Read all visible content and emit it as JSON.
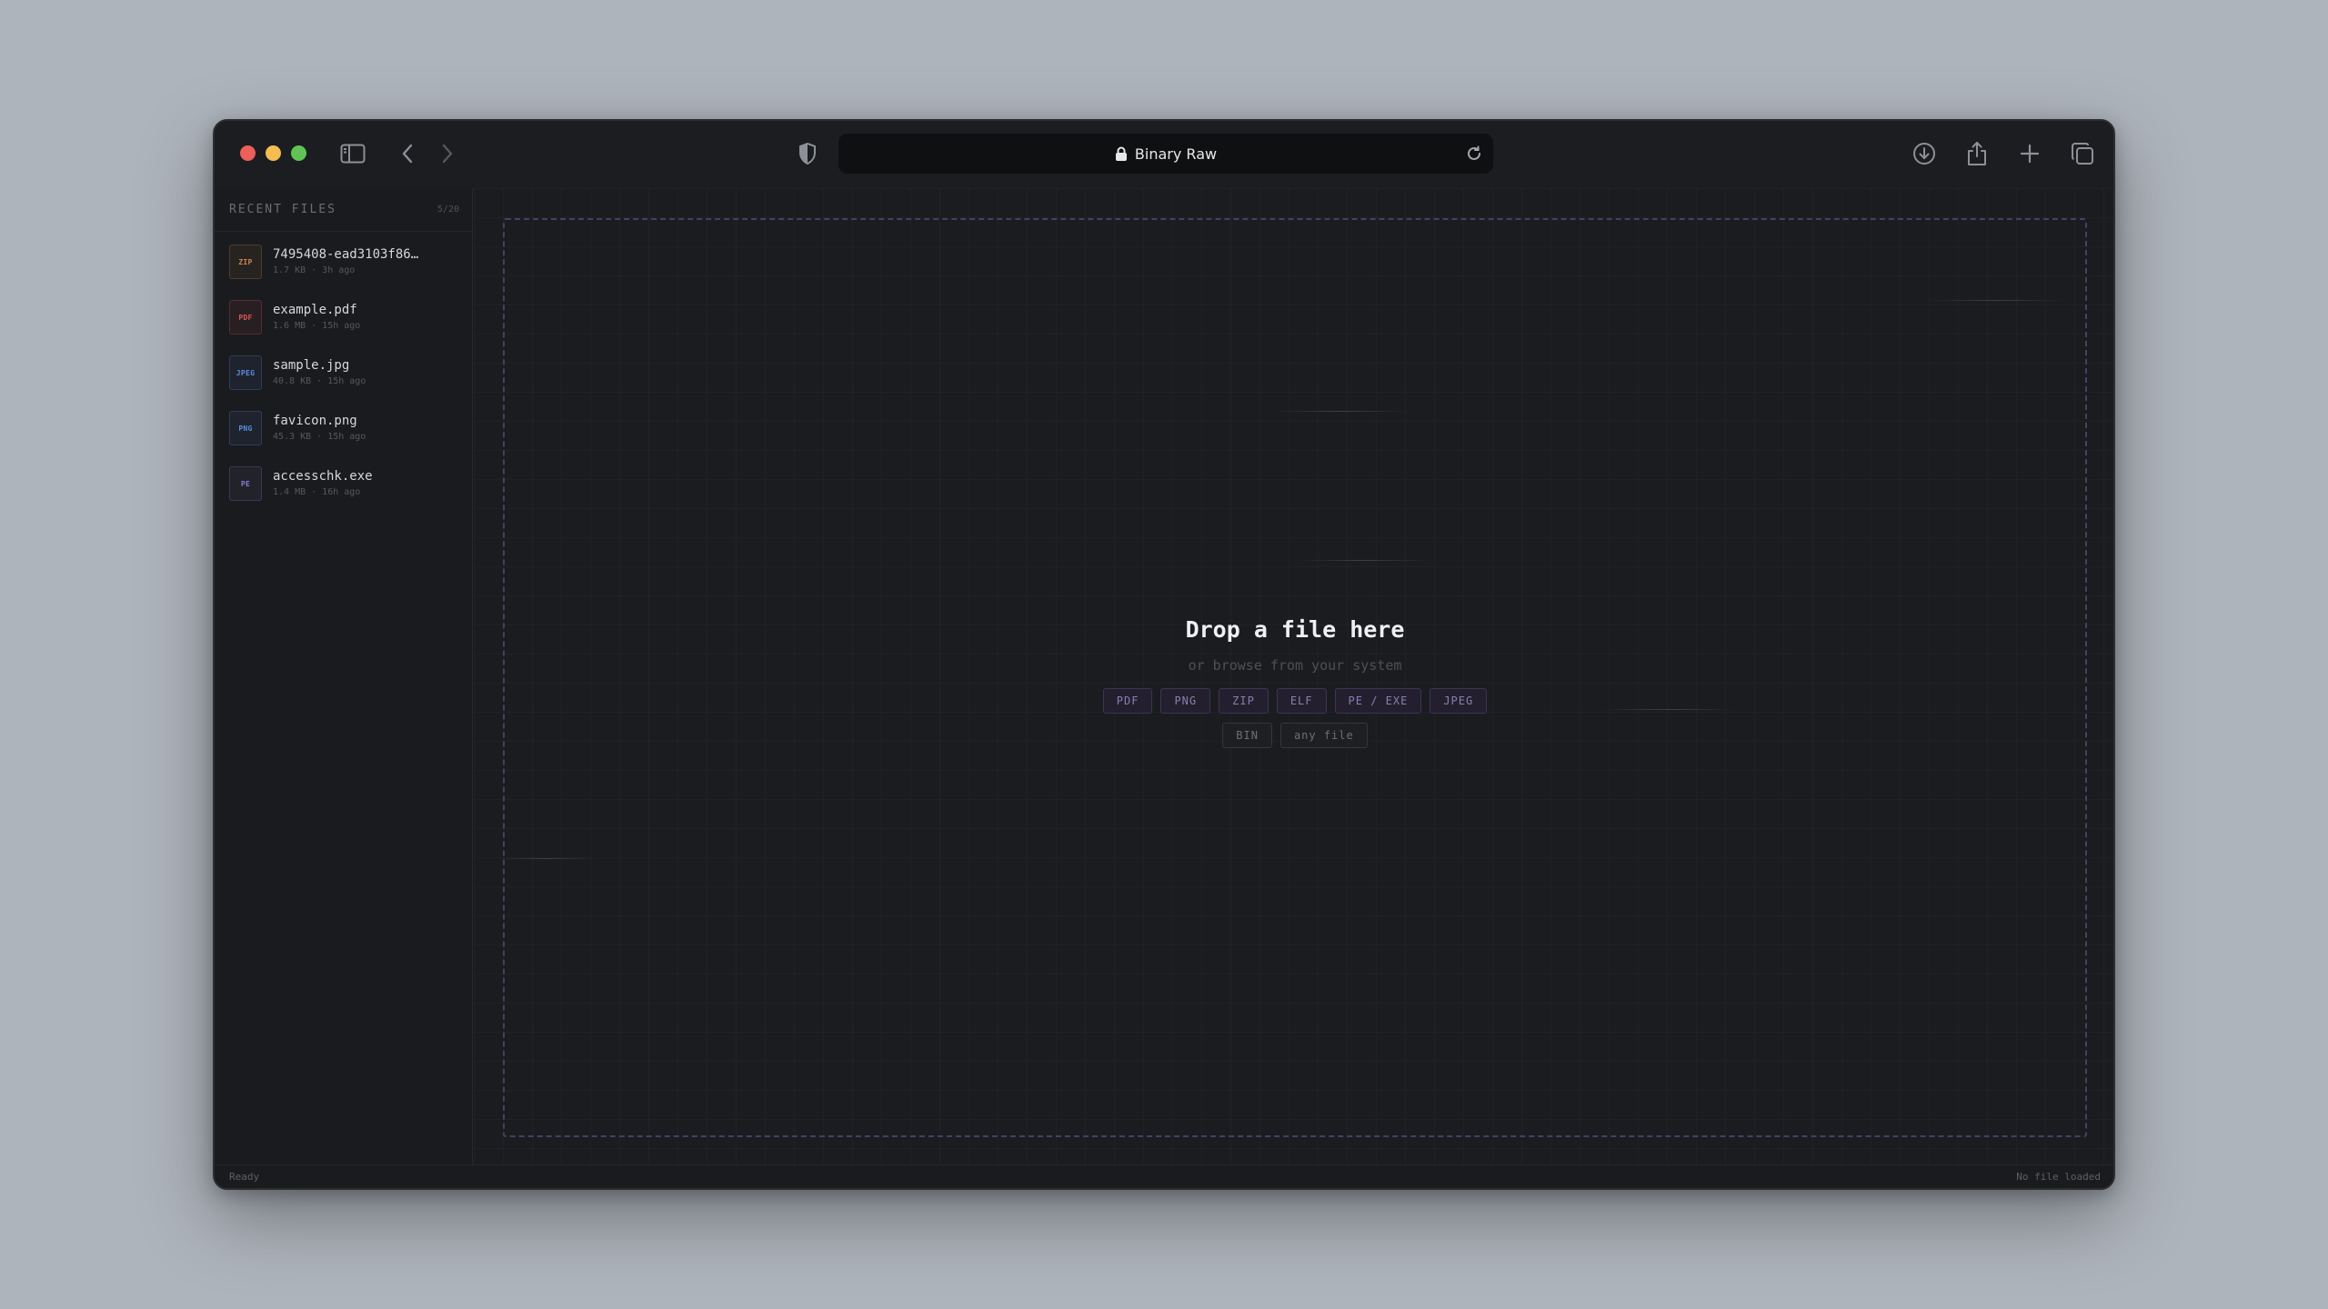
{
  "window": {
    "url_title": "Binary Raw"
  },
  "sidebar": {
    "title": "RECENT FILES",
    "count": "5/20",
    "files": [
      {
        "badge": "ZIP",
        "name": "7495408-ead3103f86…",
        "meta": "1.7 KB · 3h ago",
        "color": "#c9874a"
      },
      {
        "badge": "PDF",
        "name": "example.pdf",
        "meta": "1.6 MB · 15h ago",
        "color": "#d9565a"
      },
      {
        "badge": "JPEG",
        "name": "sample.jpg",
        "meta": "40.8 KB · 15h ago",
        "color": "#5a8fe0"
      },
      {
        "badge": "PNG",
        "name": "favicon.png",
        "meta": "45.3 KB · 15h ago",
        "color": "#5a8fe0"
      },
      {
        "badge": "PE",
        "name": "accesschk.exe",
        "meta": "1.4 MB · 16h ago",
        "color": "#8a7bd0"
      }
    ]
  },
  "dropzone": {
    "title": "Drop a file here",
    "subtitle": "or browse from your system",
    "formats_row1": [
      "PDF",
      "PNG",
      "ZIP",
      "ELF",
      "PE / EXE",
      "JPEG"
    ],
    "formats_row2": [
      "BIN",
      "any file"
    ]
  },
  "status": {
    "left": "Ready",
    "right": "No file loaded"
  },
  "icons": {
    "sidebar_toggle": "sidebar-toggle-icon",
    "back": "chevron-left-icon",
    "forward": "chevron-right-icon",
    "shield": "shield-icon",
    "lock": "lock-icon",
    "reload": "reload-icon",
    "download": "download-icon",
    "share": "share-icon",
    "new_tab": "plus-icon",
    "tabs": "tabs-overview-icon"
  }
}
